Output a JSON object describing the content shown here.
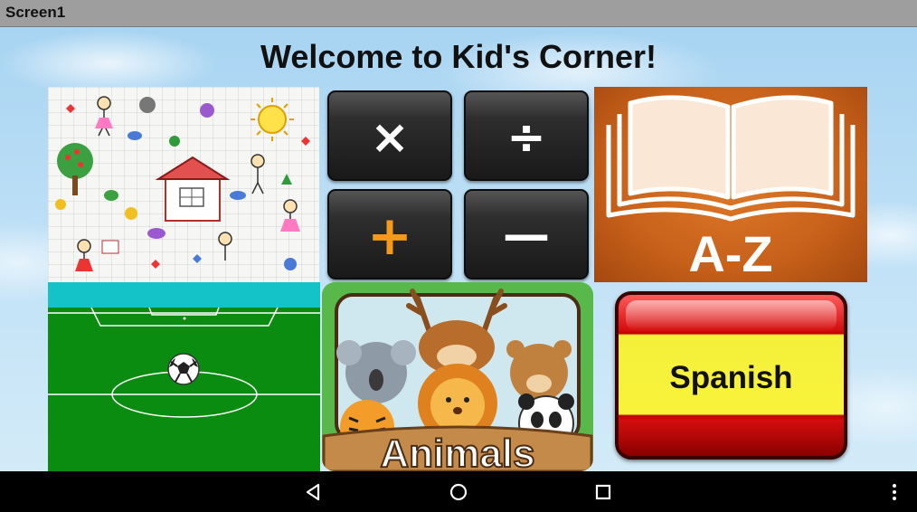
{
  "window": {
    "title": "Screen1"
  },
  "main": {
    "heading": "Welcome to Kid's Corner!",
    "tiles": {
      "math": {
        "keys": [
          "×",
          "÷",
          "+",
          "—"
        ]
      },
      "az": {
        "caption": "A-Z"
      },
      "animals": {
        "caption": "Animals"
      },
      "spanish": {
        "label": "Spanish"
      }
    }
  },
  "navbar": {
    "buttons": [
      "back-icon",
      "home-icon",
      "recents-icon",
      "overflow-menu-icon"
    ]
  },
  "colors": {
    "titlebar": "#9e9e9e",
    "sky": "#a8d4f2",
    "math_key": "#222222",
    "plus_orange": "#f39a1a",
    "book_orange": "#c8611a",
    "field_green": "#0a8c10",
    "spanish_red": "#c20000",
    "spanish_yellow": "#f4f03a"
  }
}
